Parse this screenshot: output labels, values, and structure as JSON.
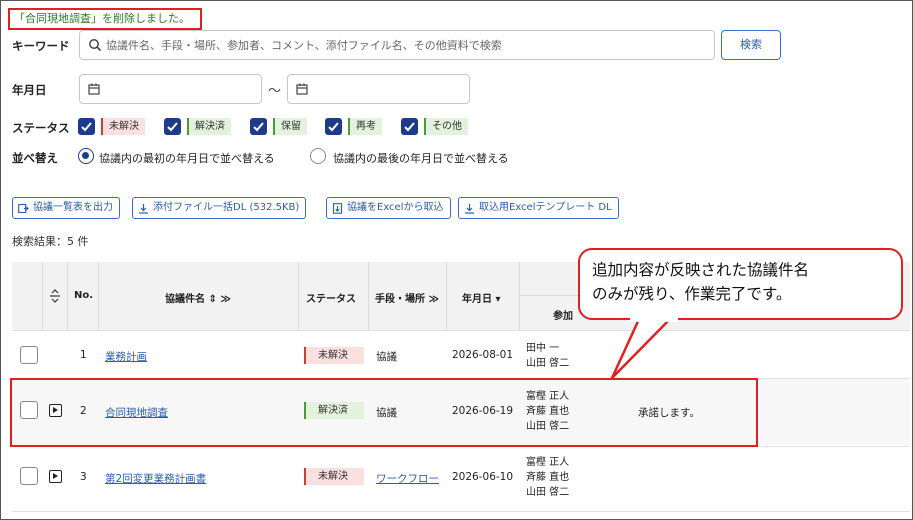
{
  "notice": "「合同現地調査」を削除しました。",
  "search": {
    "keyword_label": "キーワード",
    "placeholder": "協議件名、手段・場所、参加者、コメント、添付ファイル名、その他資料で検索",
    "button": "検索",
    "date_label": "年月日",
    "tilde": "〜",
    "status_label": "ステータス",
    "statuses": [
      "未解決",
      "解決済",
      "保留",
      "再考",
      "その他"
    ],
    "sort_label": "並べ替え",
    "sort_options": [
      "協議内の最初の年月日で並べ替える",
      "協議内の最後の年月日で並べ替える"
    ]
  },
  "toolbar": {
    "export_list": "協議一覧表を出力",
    "bulk_dl": "添付ファイル一括DL (532.5KB)",
    "import_excel": "協議をExcelから取込",
    "template_dl": "取込用Excelテンプレート DL"
  },
  "result_count": "検索結果：5 件",
  "table": {
    "headers": {
      "no": "No.",
      "title": "協議件名 ⇕ ≫",
      "status": "ステータス",
      "method": "手段・場所 ≫",
      "date": "年月日 ▾",
      "participants": "参加"
    },
    "rows": [
      {
        "no": "1",
        "title": "業務計画",
        "status": "未解決",
        "method": "協議",
        "date": "2026-08-01",
        "participants": [
          "田中 一",
          "山田 啓二"
        ],
        "comment": ""
      },
      {
        "no": "2",
        "title": "合同現地調査",
        "status": "解決済",
        "method": "協議",
        "date": "2026-06-19",
        "participants": [
          "富樫 正人",
          "斉藤 直也",
          "山田 啓二"
        ],
        "comment": "承諾します。"
      },
      {
        "no": "3",
        "title": "第2回変更業務計画書",
        "status": "未解決",
        "method": "ワークフロー",
        "date": "2026-06-10",
        "participants": [
          "富樫 正人",
          "斉藤 直也",
          "山田 啓二"
        ],
        "comment": ""
      }
    ]
  },
  "callout": [
    "追加内容が反映された協議件名",
    "のみが残り、作業完了です。"
  ]
}
